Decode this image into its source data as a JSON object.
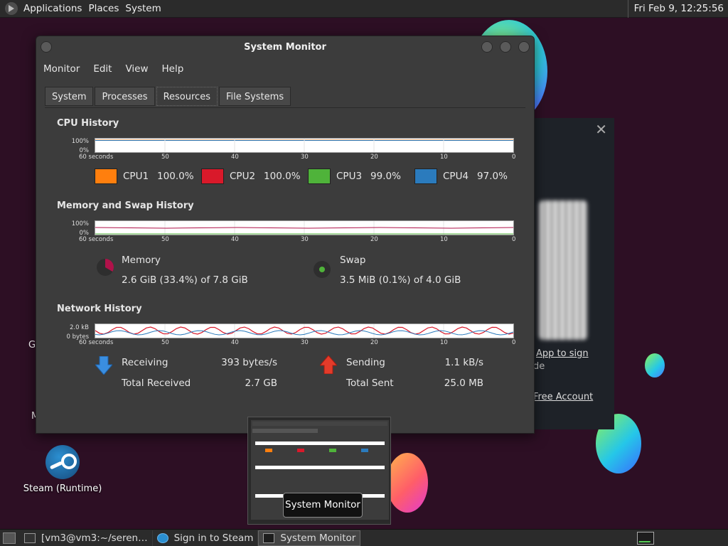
{
  "top_panel": {
    "menus": [
      "Applications",
      "Places",
      "System"
    ],
    "clock": "Fri Feb  9, 12:25:56"
  },
  "desktop": {
    "steam_icon_label": "Steam (Runtime)",
    "frag_g": "G",
    "frag_m": "M"
  },
  "steam_dialog": {
    "text1": "App to sign",
    "text1_prefix": "",
    "text2": "de",
    "text3": "Free Account",
    "close": "✕"
  },
  "window": {
    "title": "System Monitor",
    "menu": [
      "Monitor",
      "Edit",
      "View",
      "Help"
    ],
    "tabs": [
      "System",
      "Processes",
      "Resources",
      "File Systems"
    ],
    "active_tab": "Resources"
  },
  "cpu": {
    "title": "CPU History",
    "y_top": "100%",
    "y_bottom": "0%",
    "x_ticks": [
      "60 seconds",
      "50",
      "40",
      "30",
      "20",
      "10",
      "0"
    ],
    "cores": [
      {
        "name": "CPU1",
        "value": "100.0%",
        "color": "#ff7f0e"
      },
      {
        "name": "CPU2",
        "value": "100.0%",
        "color": "#d9192a"
      },
      {
        "name": "CPU3",
        "value": "99.0%",
        "color": "#4fb33a"
      },
      {
        "name": "CPU4",
        "value": "97.0%",
        "color": "#2b7bbd"
      }
    ]
  },
  "memory": {
    "title": "Memory and Swap History",
    "y_top": "100%",
    "y_bottom": "0%",
    "x_ticks": [
      "60 seconds",
      "50",
      "40",
      "30",
      "20",
      "10",
      "0"
    ],
    "memory_label": "Memory",
    "memory_value": "2.6 GiB (33.4%) of 7.8 GiB",
    "memory_fraction": 0.334,
    "memory_color": "#b0124a",
    "swap_label": "Swap",
    "swap_value": "3.5 MiB (0.1%) of 4.0 GiB",
    "swap_fraction": 0.001,
    "swap_color": "#4fb33a"
  },
  "network": {
    "title": "Network History",
    "y_top": "2.0 kB",
    "y_bottom": "0 bytes",
    "x_ticks": [
      "60 seconds",
      "50",
      "40",
      "30",
      "20",
      "10",
      "0"
    ],
    "receiving_label": "Receiving",
    "receiving_value": "393 bytes/s",
    "total_received_label": "Total Received",
    "total_received_value": "2.7 GB",
    "sending_label": "Sending",
    "sending_value": "1.1 kB/s",
    "total_sent_label": "Total Sent",
    "total_sent_value": "25.0 MB",
    "receive_color": "#2b7bbd",
    "send_color": "#d9192a"
  },
  "tooltip": "System Monitor",
  "taskbar": {
    "items": [
      {
        "label": "[vm3@vm3:~/seren…"
      },
      {
        "label": "Sign in to Steam"
      },
      {
        "label": "System Monitor"
      }
    ]
  }
}
